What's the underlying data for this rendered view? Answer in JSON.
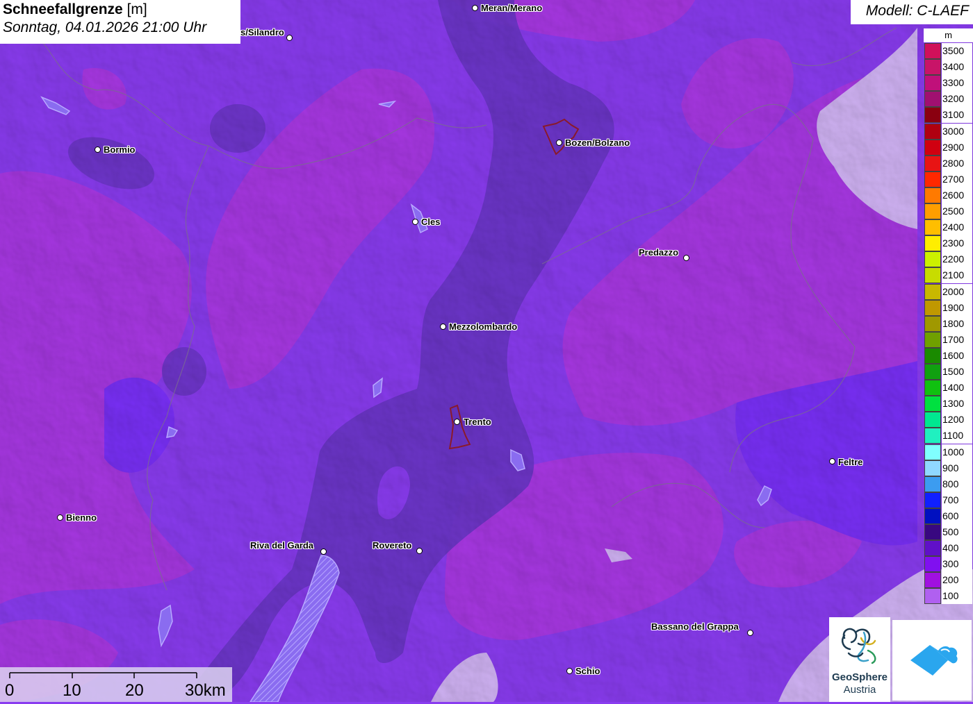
{
  "header": {
    "title_bold": "Schneefallgrenze",
    "title_unit": " [m]",
    "datetime": "Sonntag, 04.01.2026 21:00 Uhr"
  },
  "model": "Modell: C-LAEF",
  "legend": {
    "unit": "m",
    "levels": [
      {
        "value": "3500",
        "color": "#d0105a"
      },
      {
        "value": "3400",
        "color": "#c81468"
      },
      {
        "value": "3300",
        "color": "#c0107a"
      },
      {
        "value": "3200",
        "color": "#a01070"
      },
      {
        "value": "3100",
        "color": "#8a0010"
      },
      {
        "value": "3000",
        "color": "#b00010"
      },
      {
        "value": "2900",
        "color": "#d00010"
      },
      {
        "value": "2800",
        "color": "#e81414"
      },
      {
        "value": "2700",
        "color": "#ff2800"
      },
      {
        "value": "2600",
        "color": "#ff7a00"
      },
      {
        "value": "2500",
        "color": "#ff9e00"
      },
      {
        "value": "2400",
        "color": "#ffbe00"
      },
      {
        "value": "2300",
        "color": "#ffee00"
      },
      {
        "value": "2200",
        "color": "#ccf000"
      },
      {
        "value": "2100",
        "color": "#c8dc00"
      },
      {
        "value": "2000",
        "color": "#c8b800"
      },
      {
        "value": "1900",
        "color": "#c09800"
      },
      {
        "value": "1800",
        "color": "#a09800"
      },
      {
        "value": "1700",
        "color": "#70a000"
      },
      {
        "value": "1600",
        "color": "#1a8a00"
      },
      {
        "value": "1500",
        "color": "#10a010"
      },
      {
        "value": "1400",
        "color": "#10c010"
      },
      {
        "value": "1300",
        "color": "#00e040"
      },
      {
        "value": "1200",
        "color": "#00e890"
      },
      {
        "value": "1100",
        "color": "#20f0c0"
      },
      {
        "value": "1000",
        "color": "#80ffff"
      },
      {
        "value": "900",
        "color": "#90d8ff"
      },
      {
        "value": "800",
        "color": "#3c9cf0"
      },
      {
        "value": "700",
        "color": "#1020ff"
      },
      {
        "value": "600",
        "color": "#0010c0"
      },
      {
        "value": "500",
        "color": "#380880"
      },
      {
        "value": "400",
        "color": "#6010c8"
      },
      {
        "value": "300",
        "color": "#8010f0"
      },
      {
        "value": "200",
        "color": "#a010e0"
      },
      {
        "value": "100",
        "color": "#b060f0"
      }
    ]
  },
  "cities": [
    {
      "name": "Meran/Merano",
      "label_side": "right"
    },
    {
      "name": "s/Silandro",
      "label_side": "left"
    },
    {
      "name": "Bozen/Bolzano",
      "label_side": "right"
    },
    {
      "name": "Bormio",
      "label_side": "right"
    },
    {
      "name": "Cles",
      "label_side": "right"
    },
    {
      "name": "Predazzo",
      "label_side": "left"
    },
    {
      "name": "Mezzolombardo",
      "label_side": "right"
    },
    {
      "name": "Trento",
      "label_side": "right"
    },
    {
      "name": "Feltre",
      "label_side": "right"
    },
    {
      "name": "Bienno",
      "label_side": "right"
    },
    {
      "name": "Riva del Garda",
      "label_side": "left"
    },
    {
      "name": "Rovereto",
      "label_side": "left"
    },
    {
      "name": "Bassano del Grappa",
      "label_side": "left"
    },
    {
      "name": "Schio",
      "label_side": "right"
    }
  ],
  "scalebar": {
    "labels": [
      "0",
      "10",
      "20",
      "30km"
    ]
  },
  "logos": {
    "geosphere_name": "GeoSphere",
    "geosphere_sub": "Austria"
  },
  "colors": {
    "base_purple": "#8a3cf0",
    "magenta": "#a83ae0",
    "dark_valley": "#6a34c0",
    "light_lavender": "#d8b8f5"
  }
}
